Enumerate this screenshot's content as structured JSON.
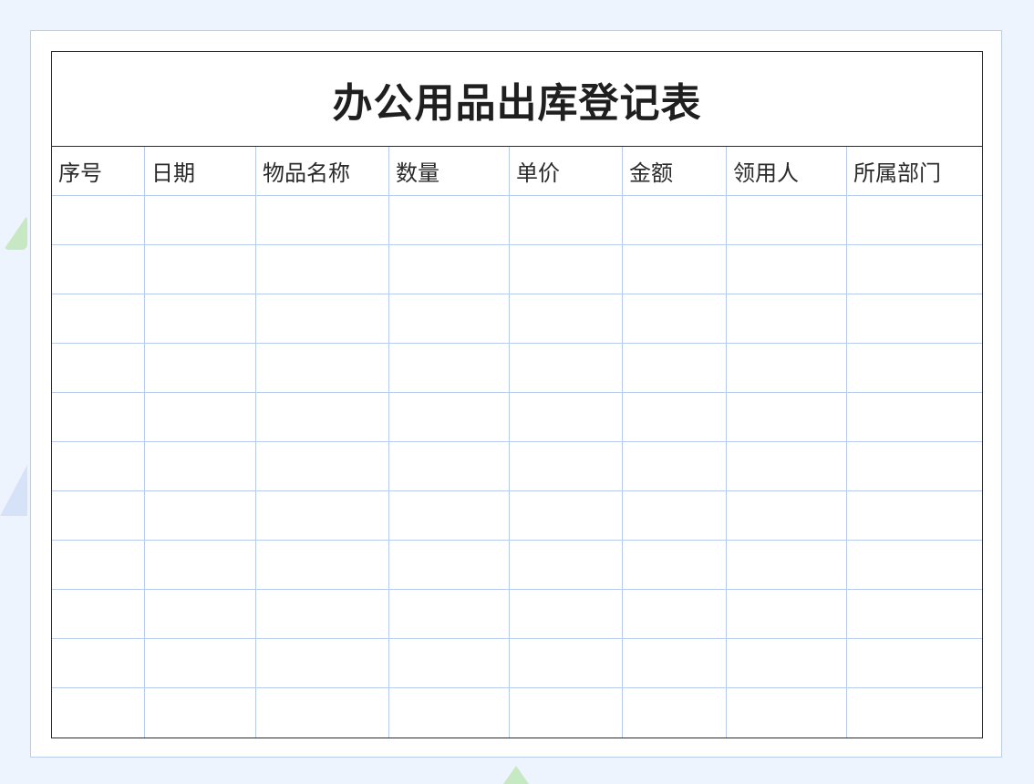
{
  "form": {
    "title": "办公用品出库登记表",
    "columns": [
      "序号",
      "日期",
      "物品名称",
      "数量",
      "单价",
      "金额",
      "领用人",
      "所属部门"
    ],
    "empty_rows": 11
  },
  "colors": {
    "background": "#eef4fd",
    "grid_line": "#b7ccec",
    "frame": "#2b2b2b"
  }
}
